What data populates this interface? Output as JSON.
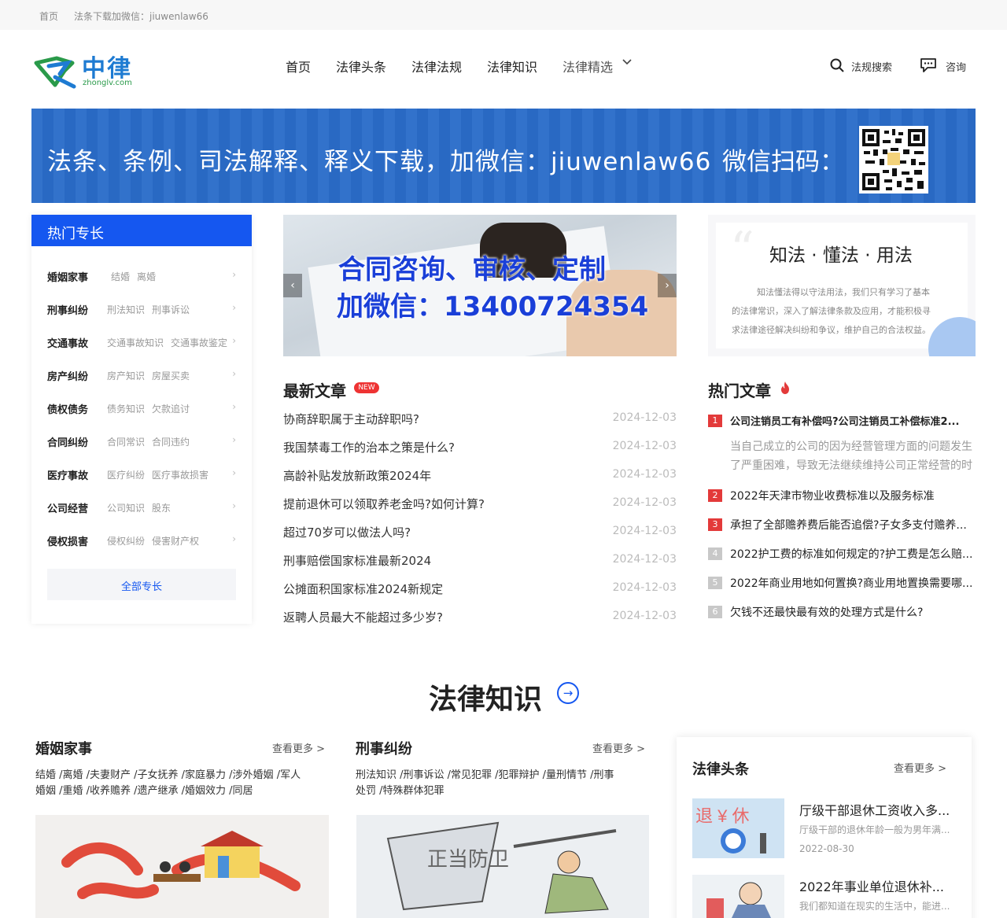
{
  "topbar": {
    "home": "首页",
    "notice": "法条下载加微信：jiuwenlaw66"
  },
  "logo": {
    "cn": "中律",
    "en": "zhonglv.com"
  },
  "nav": {
    "items": [
      "首页",
      "法律头条",
      "法律法规",
      "法律知识",
      "法律精选"
    ],
    "search": "法规搜索",
    "consult": "咨询"
  },
  "banner": {
    "text": "法条、条例、司法解释、释义下载，加微信：jiuwenlaw66",
    "scan": "微信扫码："
  },
  "sidebar": {
    "title": "热门专长",
    "categories": [
      {
        "name": "婚姻家事",
        "tags": [
          "结婚",
          "离婚"
        ]
      },
      {
        "name": "刑事纠纷",
        "tags": [
          "刑法知识",
          "刑事诉讼"
        ]
      },
      {
        "name": "交通事故",
        "tags": [
          "交通事故知识",
          "交通事故鉴定"
        ]
      },
      {
        "name": "房产纠纷",
        "tags": [
          "房产知识",
          "房屋买卖"
        ]
      },
      {
        "name": "债权债务",
        "tags": [
          "债务知识",
          "欠款追讨"
        ]
      },
      {
        "name": "合同纠纷",
        "tags": [
          "合同常识",
          "合同违约"
        ]
      },
      {
        "name": "医疗事故",
        "tags": [
          "医疗纠纷",
          "医疗事故损害"
        ]
      },
      {
        "name": "公司经营",
        "tags": [
          "公司知识",
          "股东"
        ]
      },
      {
        "name": "侵权损害",
        "tags": [
          "侵权纠纷",
          "侵害财产权"
        ]
      }
    ],
    "all_button": "全部专长"
  },
  "slider": {
    "line1": "合同咨询、审核、定制",
    "line2": "加微信：13400724354",
    "prev": "‹",
    "next": "›"
  },
  "motto": {
    "title": "知法 · 懂法 · 用法",
    "lines": [
      "知法懂法得以守法用法，我们只有学习了基本",
      "的法律常识，深入了解法律条款及应用，才能积极寻",
      "求法律途径解决纠纷和争议，维护自己的合法权益。"
    ]
  },
  "latest": {
    "title": "最新文章",
    "badge": "NEW",
    "articles": [
      {
        "title": "协商辞职属于主动辞职吗?",
        "date": "2024-12-03"
      },
      {
        "title": "我国禁毒工作的治本之策是什么?",
        "date": "2024-12-03"
      },
      {
        "title": "高龄补贴发放新政策2024年",
        "date": "2024-12-03"
      },
      {
        "title": "提前退休可以领取养老金吗?如何计算?",
        "date": "2024-12-03"
      },
      {
        "title": "超过70岁可以做法人吗?",
        "date": "2024-12-03"
      },
      {
        "title": "刑事赔偿国家标准最新2024",
        "date": "2024-12-03"
      },
      {
        "title": "公摊面积国家标准2024新规定",
        "date": "2024-12-03"
      },
      {
        "title": "返聘人员最大不能超过多少岁?",
        "date": "2024-12-03"
      }
    ]
  },
  "hot": {
    "title": "热门文章",
    "first": {
      "num": "1",
      "title": "公司注销员工有补偿吗?公司注销员工补偿标准2...",
      "desc1": "当自己成立的公司的因为经营管理方面的问题发生",
      "desc2": "了严重困难，导致无法继续维持公司正常经营的时"
    },
    "items": [
      {
        "num": "2",
        "title": "2022年天津市物业收费标准以及服务标准"
      },
      {
        "num": "3",
        "title": "承担了全部赡养费后能否追偿?子女多支付赡养..."
      },
      {
        "num": "4",
        "title": "2022护工费的标准如何规定的?护工费是怎么赔..."
      },
      {
        "num": "5",
        "title": "2022年商业用地如何置换?商业用地置换需要哪..."
      },
      {
        "num": "6",
        "title": "欠钱不还最快最有效的处理方式是什么?"
      }
    ],
    "colors": {
      "red": "#e33a3a",
      "gray": "#c8c8c8"
    }
  },
  "knowledge": {
    "title": "法律知识",
    "arrow": "→",
    "columns": [
      {
        "title": "婚姻家事",
        "more": "查看更多 >",
        "tags1": "结婚 /离婚 /夫妻财产 /子女抚养 /家庭暴力 /涉外婚姻 /军人",
        "tags2": "婚姻 /重婚 /收养赡养 /遗产继承 /婚姻效力 /同居"
      },
      {
        "title": "刑事纠纷",
        "more": "查看更多 >",
        "tags1": "刑法知识 /刑事诉讼 /常见犯罪 /犯罪辩护 /量刑情节 /刑事",
        "tags2": "处罚 /特殊群体犯罪"
      }
    ],
    "pic2_text": "正当防卫"
  },
  "news": {
    "title": "法律头条",
    "more": "查看更多 >",
    "items": [
      {
        "title": "厅级干部退休工资收入多...",
        "desc": "厅级干部的退休年龄一般为男年满...",
        "date": "2022-08-30",
        "thumb_text": "退 ¥ 休"
      },
      {
        "title": "2022年事业单位退休补...",
        "desc": "我们都知道在现实的生活中，能进..."
      }
    ]
  }
}
